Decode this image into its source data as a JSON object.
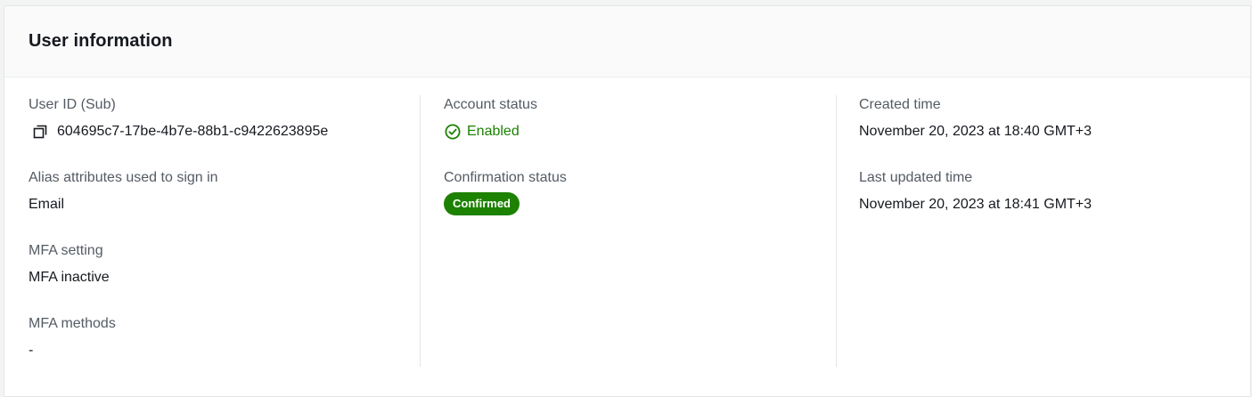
{
  "panel": {
    "title": "User information"
  },
  "column1": {
    "user_id": {
      "label": "User ID (Sub)",
      "value": "604695c7-17be-4b7e-88b1-c9422623895e",
      "icon": "copy-icon"
    },
    "alias": {
      "label": "Alias attributes used to sign in",
      "value": "Email"
    },
    "mfa_setting": {
      "label": "MFA setting",
      "value": "MFA inactive"
    },
    "mfa_methods": {
      "label": "MFA methods",
      "value": "-"
    }
  },
  "column2": {
    "account_status": {
      "label": "Account status",
      "value": "Enabled",
      "icon": "check-circle-icon",
      "color": "#1d8102"
    },
    "confirmation_status": {
      "label": "Confirmation status",
      "value": "Confirmed",
      "color": "#1d8102"
    }
  },
  "column3": {
    "created_time": {
      "label": "Created time",
      "value": "November 20, 2023 at 18:40 GMT+3"
    },
    "last_updated_time": {
      "label": "Last updated time",
      "value": "November 20, 2023 at 18:41 GMT+3"
    }
  }
}
